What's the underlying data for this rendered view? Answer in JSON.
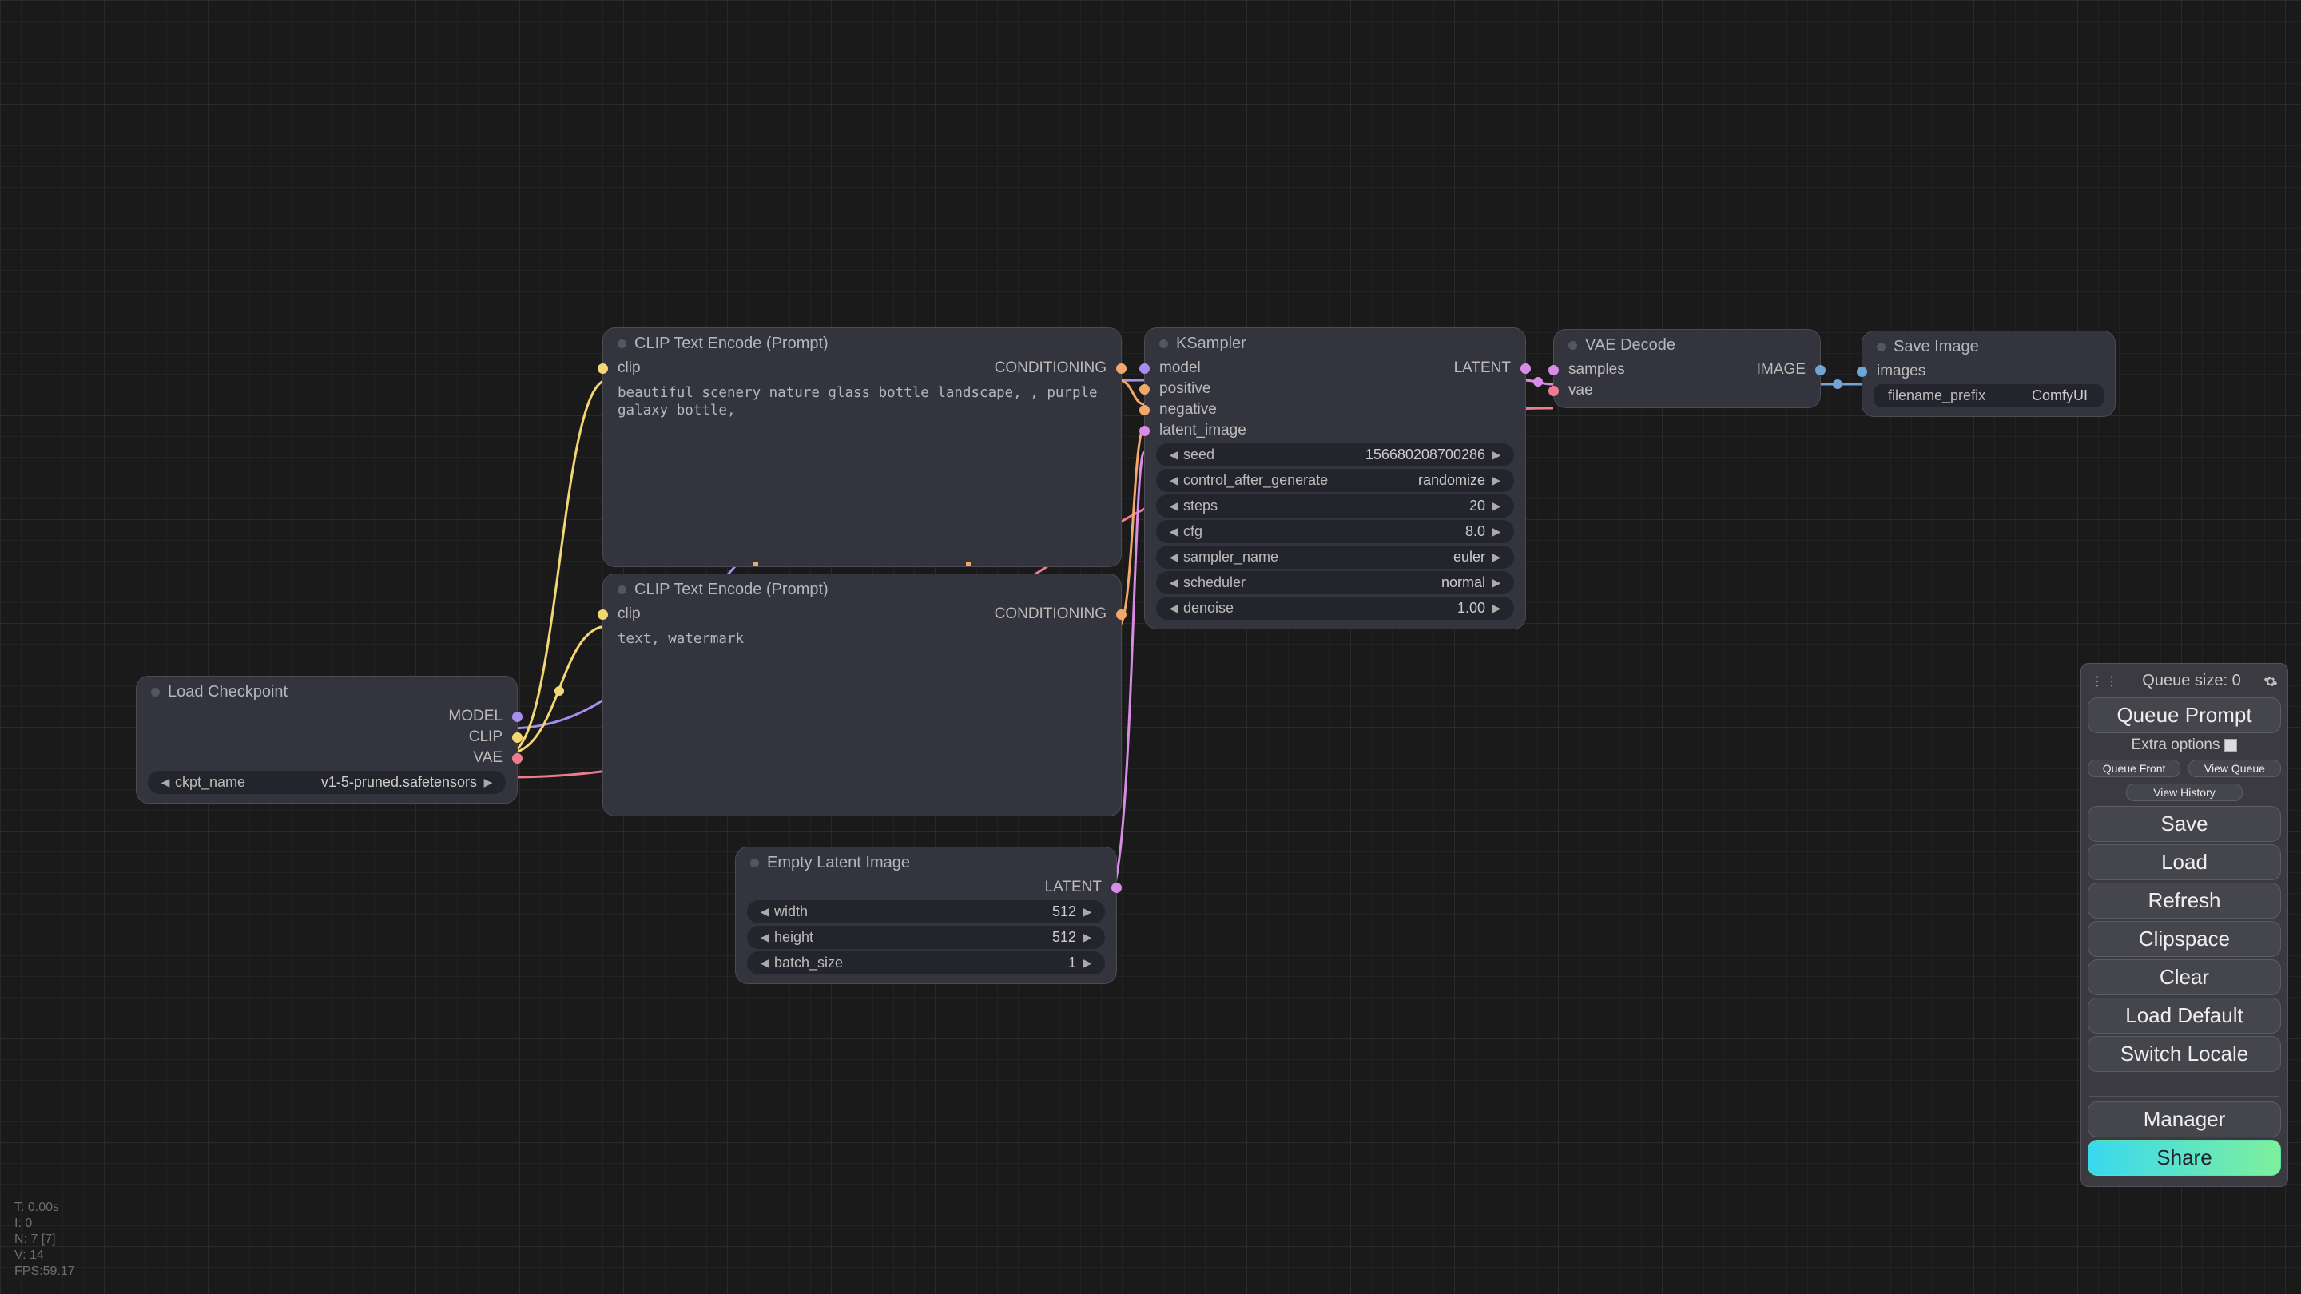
{
  "nodes": {
    "load_checkpoint": {
      "title": "Load Checkpoint",
      "outputs": {
        "model": "MODEL",
        "clip": "CLIP",
        "vae": "VAE"
      },
      "widgets": {
        "ckpt_name": {
          "label": "ckpt_name",
          "value": "v1-5-pruned.safetensors"
        }
      }
    },
    "clip_pos": {
      "title": "CLIP Text Encode (Prompt)",
      "input_label": "clip",
      "output_label": "CONDITIONING",
      "text": "beautiful scenery nature glass bottle landscape, , purple galaxy bottle,"
    },
    "clip_neg": {
      "title": "CLIP Text Encode (Prompt)",
      "input_label": "clip",
      "output_label": "CONDITIONING",
      "text": "text, watermark"
    },
    "empty_latent": {
      "title": "Empty Latent Image",
      "output_label": "LATENT",
      "widgets": {
        "width": {
          "label": "width",
          "value": "512"
        },
        "height": {
          "label": "height",
          "value": "512"
        },
        "batch_size": {
          "label": "batch_size",
          "value": "1"
        }
      }
    },
    "ksampler": {
      "title": "KSampler",
      "inputs": {
        "model": "model",
        "positive": "positive",
        "negative": "negative",
        "latent_image": "latent_image"
      },
      "output_label": "LATENT",
      "widgets": {
        "seed": {
          "label": "seed",
          "value": "156680208700286"
        },
        "control_after_generate": {
          "label": "control_after_generate",
          "value": "randomize"
        },
        "steps": {
          "label": "steps",
          "value": "20"
        },
        "cfg": {
          "label": "cfg",
          "value": "8.0"
        },
        "sampler_name": {
          "label": "sampler_name",
          "value": "euler"
        },
        "scheduler": {
          "label": "scheduler",
          "value": "normal"
        },
        "denoise": {
          "label": "denoise",
          "value": "1.00"
        }
      }
    },
    "vae_decode": {
      "title": "VAE Decode",
      "inputs": {
        "samples": "samples",
        "vae": "vae"
      },
      "output_label": "IMAGE"
    },
    "save_image": {
      "title": "Save Image",
      "input_label": "images",
      "widgets": {
        "filename_prefix": {
          "label": "filename_prefix",
          "value": "ComfyUI"
        }
      }
    }
  },
  "panel": {
    "queue_size_label": "Queue size: 0",
    "queue_prompt": "Queue Prompt",
    "extra_options": "Extra options",
    "queue_front": "Queue Front",
    "view_queue": "View Queue",
    "view_history": "View History",
    "save": "Save",
    "load": "Load",
    "refresh": "Refresh",
    "clipspace": "Clipspace",
    "clear": "Clear",
    "load_default": "Load Default",
    "switch_locale": "Switch Locale",
    "manager": "Manager",
    "share": "Share"
  },
  "debug": {
    "t": "T: 0.00s",
    "i": "I: 0",
    "n": "N: 7 [7]",
    "v": "V: 14",
    "fps": "FPS:59.17"
  }
}
